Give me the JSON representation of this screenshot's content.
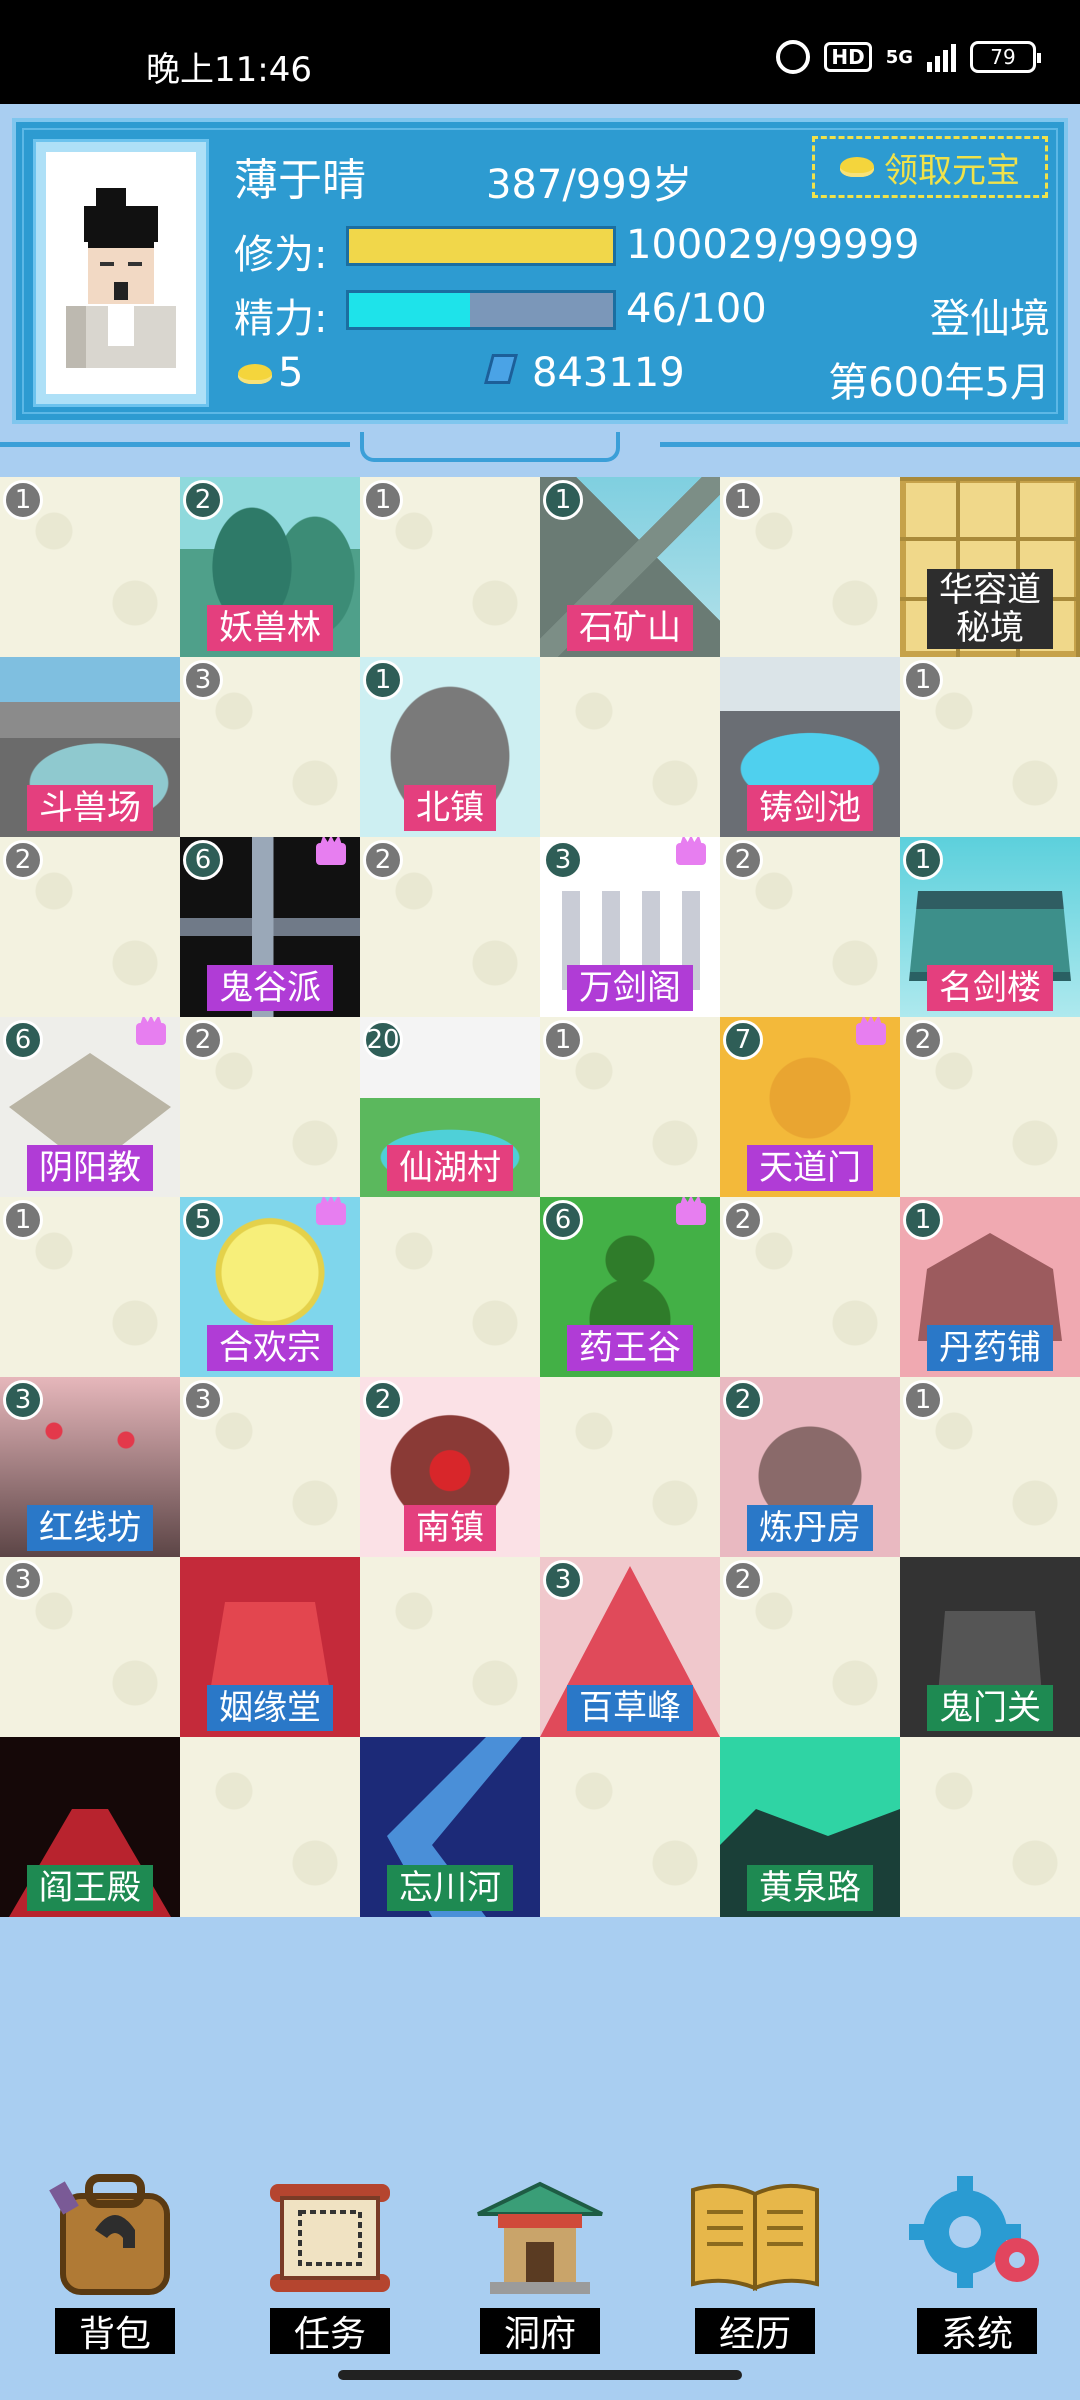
{
  "status_bar": {
    "time": "晚上11:46",
    "network": "5G",
    "hd": "HD",
    "battery": "79"
  },
  "player": {
    "name": "薄于晴",
    "age": "387/999岁",
    "claim_button": "领取元宝",
    "cultivation_label": "修为:",
    "cultivation_value": "100029/99999",
    "cultivation_progress": 1.0,
    "energy_label": "精力:",
    "energy_value": "46/100",
    "energy_progress": 0.46,
    "realm": "登仙境",
    "gold": "5",
    "spirit_stones": "843119",
    "date": "第600年5月"
  },
  "colors": {
    "header_bg": "#2d9bd1",
    "page_bg": "#a9cef1",
    "cultivation_fill": "#f1d74a",
    "energy_fill": "#1ee3ea"
  },
  "grid": [
    {
      "badge": "1"
    },
    {
      "badge": "2",
      "label": "妖兽林",
      "scene": "forest"
    },
    {
      "badge": "1"
    },
    {
      "badge": "1",
      "label": "石矿山",
      "scene": "mountain"
    },
    {
      "badge": "1"
    },
    {
      "label": "华容道\n秘境",
      "scene": "puzzle"
    },
    {
      "label": "斗兽场",
      "scene": "arena"
    },
    {
      "badge": "3"
    },
    {
      "badge": "1",
      "label": "北镇",
      "scene": "stone"
    },
    {},
    {
      "label": "铸剑池",
      "scene": "pool"
    },
    {
      "badge": "1"
    },
    {
      "badge": "2"
    },
    {
      "badge": "6",
      "label": "鬼谷派",
      "scene": "ghost",
      "crown": true
    },
    {
      "badge": "2"
    },
    {
      "badge": "3",
      "label": "万剑阁",
      "scene": "swords",
      "crown": true
    },
    {
      "badge": "2"
    },
    {
      "badge": "1",
      "label": "名剑楼",
      "scene": "pavilion"
    },
    {
      "badge": "6",
      "label": "阴阳教",
      "scene": "altar",
      "crown": true
    },
    {
      "badge": "2"
    },
    {
      "badge": "20",
      "label": "仙湖村",
      "scene": "village"
    },
    {
      "badge": "1"
    },
    {
      "badge": "7",
      "label": "天道门",
      "scene": "taiji",
      "crown": true
    },
    {
      "badge": "2"
    },
    {
      "badge": "1"
    },
    {
      "badge": "5",
      "label": "合欢宗",
      "scene": "rose",
      "crown": true
    },
    {},
    {
      "badge": "6",
      "label": "药王谷",
      "scene": "gourd",
      "crown": true
    },
    {
      "badge": "2"
    },
    {
      "badge": "1",
      "label": "丹药铺",
      "scene": "shop"
    },
    {
      "badge": "3",
      "label": "红线坊",
      "scene": "redstreet"
    },
    {
      "badge": "3"
    },
    {
      "badge": "2",
      "label": "南镇",
      "scene": "jar"
    },
    {},
    {
      "badge": "2",
      "label": "炼丹房",
      "scene": "teapot"
    },
    {
      "badge": "1"
    },
    {
      "badge": "3"
    },
    {
      "label": "姻缘堂",
      "scene": "wedding"
    },
    {},
    {
      "badge": "3",
      "label": "百草峰",
      "scene": "redpeak"
    },
    {
      "badge": "2"
    },
    {
      "label": "鬼门关",
      "scene": "gate"
    },
    {
      "label": "阎王殿",
      "scene": "hall"
    },
    {},
    {
      "label": "忘川河",
      "scene": "river"
    },
    {},
    {
      "label": "黄泉路",
      "scene": "greenroad"
    },
    {}
  ],
  "nav": [
    {
      "label": "背包",
      "icon": "backpack-icon"
    },
    {
      "label": "任务",
      "icon": "scroll-icon"
    },
    {
      "label": "洞府",
      "icon": "temple-icon"
    },
    {
      "label": "经历",
      "icon": "book-icon"
    },
    {
      "label": "系统",
      "icon": "gear-icon"
    }
  ]
}
